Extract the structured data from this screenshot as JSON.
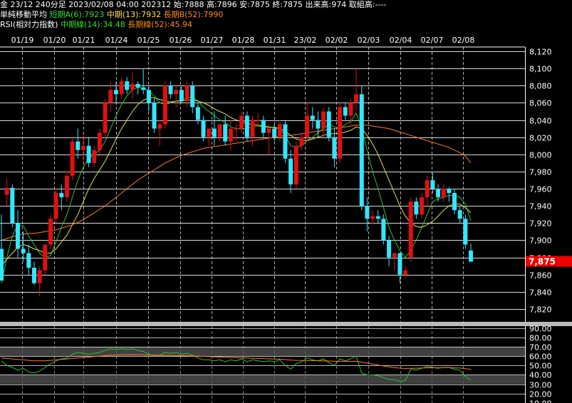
{
  "header": {
    "line1_main": "金 23/12 240分足 2023/02/08 04:00 202312 始:7888 高:7896 安:7875 終:7875 出来高:974 取組高:----",
    "line2_label": "単純移動平均",
    "line2_ma_short": "短期A(6):7923",
    "line2_ma_mid": "中期(13):7932",
    "line2_ma_long": "長期B(52):7990",
    "line3_label": "RSI(相対力指数)",
    "line3_rsi_mid": "中期線(14):34.48",
    "line3_rsi_long": "長期線(52):45.94"
  },
  "colors": {
    "up_candle": "#e01010",
    "down_candle": "#33e6ff",
    "ma_short": "#2fbf2f",
    "ma_mid": "#e6e24a",
    "ma_long": "#ff7a1f",
    "price_tag_bg": "#ee0000",
    "grid": "#ffffff",
    "rsi_band": "#555555"
  },
  "price_tag": "7,875",
  "chart_data": [
    {
      "type": "candlestick",
      "title": "",
      "x_ticks": [
        "01/19",
        "01/20",
        "01/21",
        "01/24",
        "01/25",
        "01/26",
        "01/27",
        "01/28",
        "01/31",
        "23/02",
        "02/02",
        "02/03",
        "02/04",
        "02/07",
        "02/08"
      ],
      "y_ticks": [
        "8,120",
        "8,100",
        "8,080",
        "8,060",
        "8,040",
        "8,020",
        "8,000",
        "7,980",
        "7,960",
        "7,940",
        "7,920",
        "7,900",
        "7,880",
        "7,860",
        "7,840",
        "7,820"
      ],
      "ylim": [
        7805,
        8125
      ],
      "candles": [
        [
          7890,
          7930,
          7853,
          7853
        ],
        [
          7953,
          7972,
          7940,
          7961
        ],
        [
          7961,
          7965,
          7915,
          7920
        ],
        [
          7920,
          7935,
          7880,
          7890
        ],
        [
          7890,
          7910,
          7875,
          7885
        ],
        [
          7885,
          7895,
          7860,
          7868
        ],
        [
          7868,
          7875,
          7848,
          7850
        ],
        [
          7850,
          7870,
          7835,
          7865
        ],
        [
          7865,
          7895,
          7860,
          7895
        ],
        [
          7895,
          7930,
          7890,
          7925
        ],
        [
          7925,
          7960,
          7920,
          7955
        ],
        [
          7955,
          7965,
          7935,
          7950
        ],
        [
          7950,
          7980,
          7945,
          7975
        ],
        [
          7975,
          8020,
          7970,
          8015
        ],
        [
          8015,
          8030,
          7995,
          8005
        ],
        [
          8005,
          8025,
          7990,
          8010
        ],
        [
          8010,
          8020,
          7985,
          7990
        ],
        [
          7990,
          8010,
          7985,
          8005
        ],
        [
          8005,
          8030,
          8000,
          8025
        ],
        [
          8025,
          8065,
          8020,
          8060
        ],
        [
          8060,
          8085,
          8050,
          8075
        ],
        [
          8075,
          8085,
          8060,
          8070
        ],
        [
          8070,
          8090,
          8065,
          8085
        ],
        [
          8085,
          8090,
          8070,
          8075
        ],
        [
          8075,
          8095,
          8065,
          8082
        ],
        [
          8082,
          8085,
          8070,
          8078
        ],
        [
          8078,
          8100,
          8070,
          8075
        ],
        [
          8075,
          8080,
          8050,
          8060
        ],
        [
          8060,
          8065,
          8025,
          8030
        ],
        [
          8030,
          8040,
          8010,
          8035
        ],
        [
          8035,
          8085,
          8030,
          8080
        ],
        [
          8080,
          8085,
          8065,
          8070
        ],
        [
          8070,
          8080,
          8055,
          8075
        ],
        [
          8075,
          8080,
          8060,
          8062
        ],
        [
          8062,
          8085,
          8055,
          8080
        ],
        [
          8080,
          8085,
          8048,
          8055
        ],
        [
          8055,
          8060,
          8035,
          8040
        ],
        [
          8040,
          8045,
          8015,
          8020
        ],
        [
          8020,
          8030,
          8010,
          8030
        ],
        [
          8030,
          8050,
          8010,
          8020
        ],
        [
          8020,
          8035,
          8015,
          8035
        ],
        [
          8035,
          8045,
          8010,
          8015
        ],
        [
          8015,
          8040,
          8005,
          8030
        ],
        [
          8030,
          8035,
          8015,
          8030
        ],
        [
          8030,
          8050,
          8025,
          8045
        ],
        [
          8045,
          8050,
          8015,
          8020
        ],
        [
          8020,
          8045,
          8010,
          8040
        ],
        [
          8040,
          8048,
          8032,
          8040
        ],
        [
          8040,
          8045,
          8020,
          8025
        ],
        [
          8025,
          8035,
          8000,
          8030
        ],
        [
          8030,
          8035,
          8015,
          8020
        ],
        [
          8020,
          8040,
          8015,
          8035
        ],
        [
          8035,
          8040,
          7990,
          7995
        ],
        [
          7995,
          8005,
          7955,
          7965
        ],
        [
          7965,
          8015,
          7960,
          8010
        ],
        [
          8010,
          8025,
          8005,
          8020
        ],
        [
          8020,
          8060,
          8015,
          8045
        ],
        [
          8045,
          8055,
          8030,
          8040
        ],
        [
          8040,
          8050,
          8020,
          8030
        ],
        [
          8030,
          8055,
          8020,
          8050
        ],
        [
          8050,
          8055,
          8015,
          8020
        ],
        [
          8020,
          8030,
          7985,
          7995
        ],
        [
          7995,
          8060,
          7990,
          8055
        ],
        [
          8055,
          8060,
          8040,
          8045
        ],
        [
          8045,
          8065,
          8035,
          8060
        ],
        [
          8060,
          8100,
          8050,
          8070
        ],
        [
          8070,
          8080,
          7935,
          7940
        ],
        [
          7940,
          7950,
          7910,
          7925
        ],
        [
          7925,
          7935,
          7918,
          7928
        ],
        [
          7928,
          7935,
          7920,
          7925
        ],
        [
          7925,
          7930,
          7895,
          7900
        ],
        [
          7900,
          7905,
          7870,
          7880
        ],
        [
          7880,
          7885,
          7865,
          7885
        ],
        [
          7885,
          7885,
          7850,
          7860
        ],
        [
          7860,
          7870,
          7855,
          7865
        ],
        [
          7880,
          7950,
          7875,
          7945
        ],
        [
          7945,
          7950,
          7925,
          7930
        ],
        [
          7930,
          7955,
          7925,
          7950
        ],
        [
          7950,
          7975,
          7940,
          7970
        ],
        [
          7970,
          7978,
          7955,
          7960
        ],
        [
          7960,
          7965,
          7945,
          7950
        ],
        [
          7950,
          7965,
          7945,
          7960
        ],
        [
          7960,
          7962,
          7945,
          7955
        ],
        [
          7955,
          7960,
          7930,
          7935
        ],
        [
          7935,
          7940,
          7920,
          7925
        ],
        [
          7925,
          7930,
          7890,
          7895
        ],
        [
          7888,
          7896,
          7875,
          7875
        ]
      ],
      "series": [
        {
          "name": "短期A(6)",
          "values": [
            7850,
            7880,
            7905,
            7918,
            7917,
            7905,
            7895,
            7885,
            7880,
            7882,
            7898,
            7915,
            7930,
            7950,
            7970,
            7985,
            7995,
            8000,
            8005,
            8015,
            8030,
            8045,
            8058,
            8068,
            8075,
            8078,
            8077,
            8074,
            8068,
            8060,
            8058,
            8060,
            8062,
            8063,
            8066,
            8067,
            8062,
            8055,
            8050,
            8045,
            8040,
            8037,
            8032,
            8030,
            8030,
            8030,
            8032,
            8033,
            8032,
            8031,
            8032,
            8030,
            8022,
            8010,
            8008,
            8010,
            8016,
            8020,
            8025,
            8030,
            8035,
            8032,
            8030,
            8035,
            8038,
            8048,
            8030,
            8005,
            7980,
            7960,
            7938,
            7915,
            7900,
            7888,
            7880,
            7888,
            7900,
            7915,
            7930,
            7945,
            7948,
            7950,
            7952,
            7952,
            7950,
            7942,
            7923
          ]
        },
        {
          "name": "中期(13)",
          "values": [
            7870,
            7878,
            7885,
            7892,
            7895,
            7893,
            7890,
            7888,
            7885,
            7885,
            7890,
            7898,
            7906,
            7918,
            7930,
            7945,
            7960,
            7972,
            7982,
            7992,
            8005,
            8018,
            8030,
            8040,
            8050,
            8058,
            8063,
            8066,
            8066,
            8064,
            8062,
            8061,
            8062,
            8062,
            8063,
            8063,
            8062,
            8060,
            8057,
            8053,
            8050,
            8047,
            8043,
            8040,
            8038,
            8036,
            8035,
            8034,
            8033,
            8032,
            8031,
            8030,
            8027,
            8022,
            8018,
            8016,
            8016,
            8018,
            8020,
            8022,
            8024,
            8024,
            8024,
            8026,
            8028,
            8032,
            8030,
            8022,
            8012,
            8000,
            7985,
            7970,
            7955,
            7940,
            7928,
            7920,
            7916,
            7915,
            7918,
            7922,
            7928,
            7935,
            7940,
            7942,
            7942,
            7938,
            7932
          ]
        },
        {
          "name": "長期B(52)",
          "values": [
            7900,
            7902,
            7904,
            7906,
            7907,
            7908,
            7908,
            7909,
            7910,
            7911,
            7912,
            7914,
            7916,
            7918,
            7921,
            7924,
            7928,
            7932,
            7936,
            7940,
            7945,
            7950,
            7955,
            7960,
            7965,
            7970,
            7974,
            7978,
            7982,
            7986,
            7990,
            7993,
            7996,
            7999,
            8001,
            8003,
            8005,
            8007,
            8008,
            8009,
            8010,
            8011,
            8012,
            8013,
            8014,
            8015,
            8016,
            8017,
            8018,
            8019,
            8020,
            8021,
            8022,
            8022,
            8023,
            8024,
            8025,
            8026,
            8027,
            8028,
            8029,
            8030,
            8031,
            8032,
            8033,
            8034,
            8034,
            8034,
            8033,
            8032,
            8031,
            8030,
            8028,
            8026,
            8024,
            8022,
            8020,
            8018,
            8016,
            8014,
            8012,
            8010,
            8008,
            8005,
            8002,
            7998,
            7990
          ]
        }
      ]
    },
    {
      "type": "line",
      "title": "RSI",
      "y_ticks": [
        "90.00",
        "80.00",
        "70.00",
        "60.00",
        "50.00",
        "40.00",
        "30.00",
        "20.00",
        "10.00"
      ],
      "ylim": [
        10,
        92
      ],
      "bands": [
        [
          70,
          60
        ],
        [
          40,
          30
        ]
      ],
      "series": [
        {
          "name": "中期線(14)",
          "values": [
            55,
            50,
            48,
            45,
            47,
            43,
            42,
            44,
            48,
            52,
            55,
            57,
            58,
            62,
            64,
            63,
            62,
            63,
            64,
            66,
            68,
            67,
            68,
            67,
            68,
            66,
            65,
            62,
            60,
            61,
            64,
            63,
            64,
            62,
            63,
            61,
            58,
            56,
            56,
            55,
            56,
            54,
            56,
            55,
            57,
            54,
            56,
            55,
            54,
            55,
            54,
            56,
            50,
            46,
            52,
            54,
            58,
            56,
            55,
            57,
            53,
            50,
            57,
            55,
            57,
            60,
            42,
            40,
            40,
            39,
            37,
            35,
            35,
            33,
            34,
            46,
            45,
            47,
            49,
            48,
            47,
            48,
            48,
            46,
            45,
            38,
            34.48
          ]
        },
        {
          "name": "長期線(52)",
          "values": [
            58,
            57.5,
            57,
            56.5,
            56,
            55.5,
            55,
            55,
            55,
            55.5,
            56,
            56.5,
            57,
            57.5,
            58,
            58.5,
            59,
            59.5,
            60,
            60.5,
            61,
            61.2,
            61.5,
            61.6,
            61.7,
            61.6,
            61.5,
            61.2,
            61,
            60.8,
            60.8,
            60.7,
            60.6,
            60.5,
            60.4,
            60.2,
            60,
            59.7,
            59.5,
            59.2,
            59,
            58.7,
            58.5,
            58.3,
            58.1,
            57.9,
            57.7,
            57.5,
            57.3,
            57.1,
            56.9,
            56.7,
            56.3,
            55.8,
            55.5,
            55.3,
            55.3,
            55.2,
            55.1,
            55,
            54.8,
            54.5,
            54.5,
            54.4,
            54.4,
            54.5,
            53.5,
            52.5,
            51.5,
            50.5,
            49.5,
            48.5,
            47.8,
            47.2,
            46.8,
            47,
            47.1,
            47.3,
            47.5,
            47.6,
            47.6,
            47.7,
            47.7,
            47.5,
            47.3,
            46.6,
            45.94
          ]
        }
      ]
    }
  ]
}
